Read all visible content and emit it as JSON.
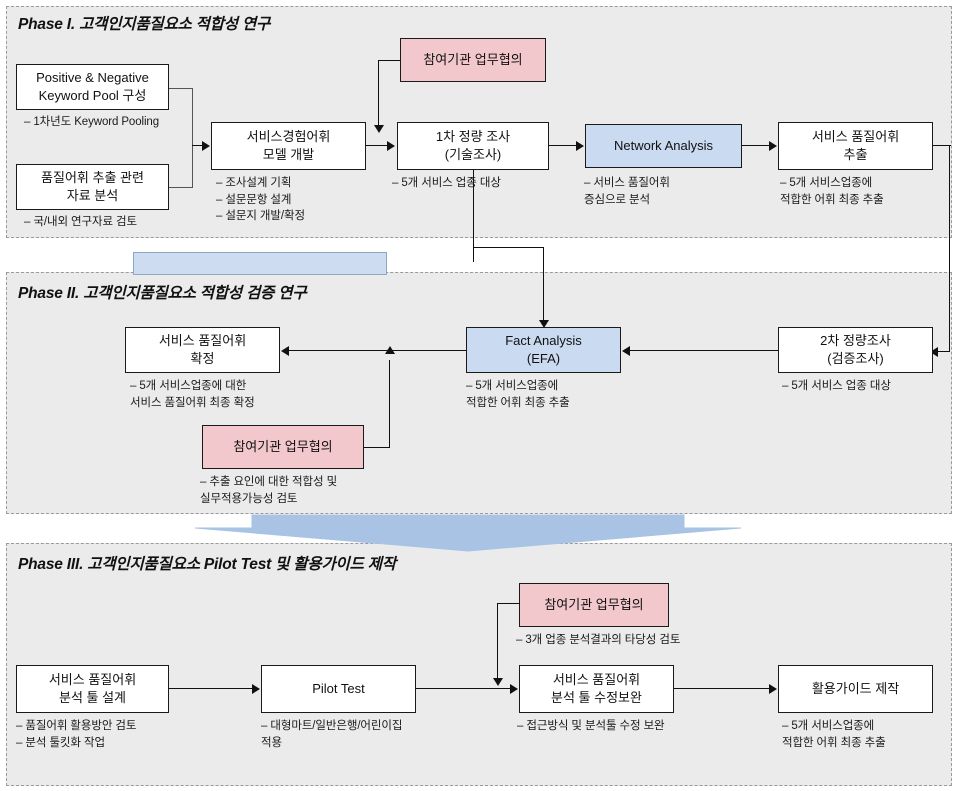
{
  "colors": {
    "panel_bg": "#ebebeb",
    "panel_border": "#9a9a9a",
    "node_blue": "#c9daf1",
    "node_pink": "#f2c8cc",
    "connector": "#111111",
    "interphase_blue": "#cddcf0"
  },
  "phases": [
    {
      "id": "phase1",
      "title": "Phase I. 고객인지품질요소 적합성 연구"
    },
    {
      "id": "phase2",
      "title": "Phase II. 고객인지품질요소 적합성 검증 연구"
    },
    {
      "id": "phase3",
      "title": "Phase III. 고객인지품질요소 Pilot Test 및 활용가이드 제작"
    }
  ],
  "phase1": {
    "nodes": {
      "keyword_pool": {
        "label": "Positive & Negative\nKeyword Pool 구성",
        "style": "white"
      },
      "data_analysis": {
        "label": "품질어휘 추출 관련\n자료 분석",
        "style": "white"
      },
      "model_dev": {
        "label": "서비스경험어휘\n모델 개발",
        "style": "white"
      },
      "meeting1": {
        "label": "참여기관 업무협의",
        "style": "pink"
      },
      "survey1": {
        "label": "1차 정량 조사\n(기술조사)",
        "style": "white"
      },
      "network": {
        "label": "Network Analysis",
        "style": "blue"
      },
      "extract": {
        "label": "서비스 품질어휘\n추출",
        "style": "white"
      }
    },
    "notes": {
      "keyword_pool": "– 1차년도 Keyword Pooling",
      "data_analysis": "– 국/내외 연구자료 검토",
      "model_dev": "– 조사설계 기획\n– 설문문항 설계\n– 설문지 개발/확정",
      "survey1": "– 5개 서비스 업종 대상",
      "network": "– 서비스 품질어휘\n   증심으로 분석",
      "extract": "– 5개 서비스업종에\n   적합한 어휘 최종 추출"
    }
  },
  "phase2": {
    "nodes": {
      "confirm": {
        "label": "서비스 품질어휘\n확정",
        "style": "white"
      },
      "meeting2": {
        "label": "참여기관 업무협의",
        "style": "pink"
      },
      "efa": {
        "label": "Fact Analysis\n(EFA)",
        "style": "blue"
      },
      "survey2": {
        "label": "2차 정량조사\n(검증조사)",
        "style": "white"
      }
    },
    "notes": {
      "confirm": "– 5개 서비스업종에  대한\n   서비스 품질어휘 최종 확정",
      "meeting2": "– 추출 요인에 대한 적합성 및\n   실무적용가능성 검토",
      "efa": "– 5개 서비스업종에\n   적합한 어휘 최종 추출",
      "survey2": "– 5개 서비스 업종 대상"
    }
  },
  "phase3": {
    "nodes": {
      "tool_design": {
        "label": "서비스 품질어휘\n분석 툴 설계",
        "style": "white"
      },
      "pilot": {
        "label": "Pilot Test",
        "style": "white"
      },
      "meeting3": {
        "label": "참여기관 업무협의",
        "style": "pink"
      },
      "tool_fix": {
        "label": "서비스 품질어휘\n분석 툴 수정보완",
        "style": "white"
      },
      "guide": {
        "label": "활용가이드 제작",
        "style": "white"
      }
    },
    "notes": {
      "tool_design": "– 품질어휘 활용방안 검토\n– 분석 툴킷화 작업",
      "pilot": "– 대형마트/일반은행/어린이집\n   적용",
      "meeting3": "– 3개 업종 분석결과의  타당성 검토",
      "tool_fix": "– 접근방식 및 분석툴 수정 보완",
      "guide": "– 5개 서비스업종에\n   적합한 어휘 최종 추출"
    }
  }
}
